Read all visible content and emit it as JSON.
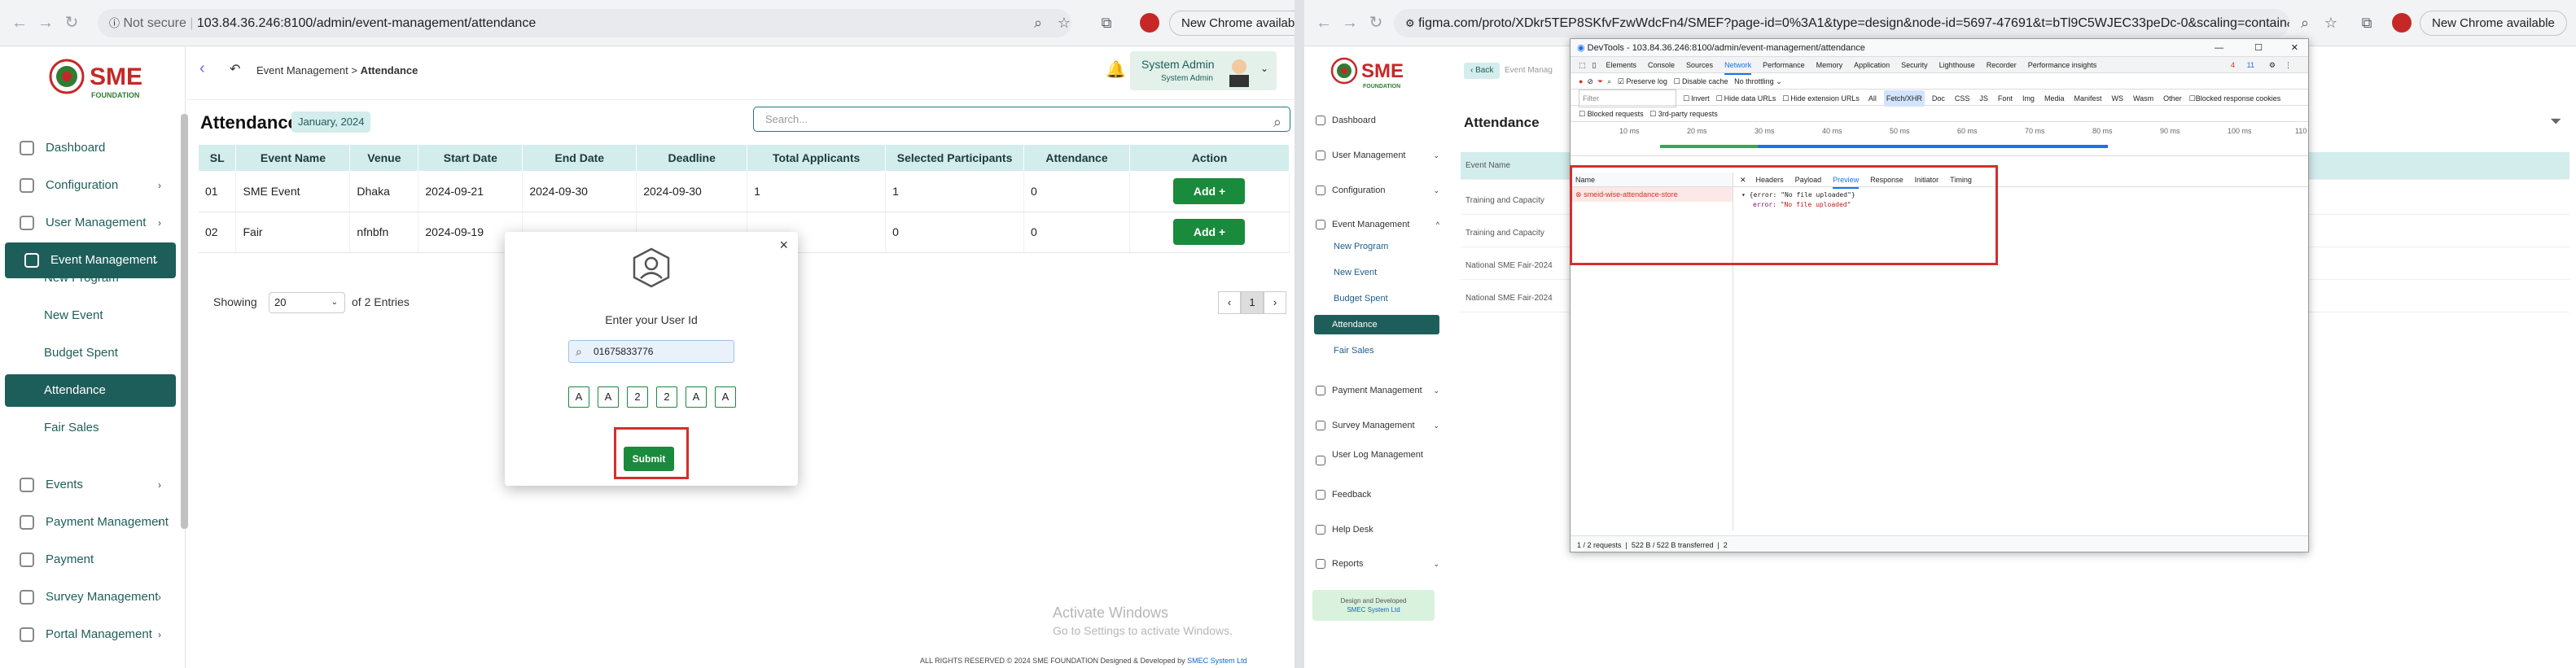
{
  "left_browser": {
    "url_security": "Not secure",
    "url": "103.84.36.246:8100/admin/event-management/attendance",
    "new_chrome": "New Chrome available"
  },
  "app": {
    "breadcrumb": {
      "parent": "Event Management",
      "sep": ">",
      "current": "Attendance"
    },
    "user": {
      "name": "System Admin",
      "role": "System Admin"
    },
    "menu": [
      {
        "label": "Dashboard",
        "icon": "grid-icon",
        "chevron": ""
      },
      {
        "label": "Configuration",
        "icon": "gear-icon",
        "chevron": "›"
      },
      {
        "label": "User Management",
        "icon": "users-icon",
        "chevron": "›"
      },
      {
        "label": "Event Management",
        "icon": "calendar-icon",
        "chevron": "⌄"
      },
      {
        "label": "Events",
        "icon": "star-icon",
        "chevron": "›"
      },
      {
        "label": "Payment Management",
        "icon": "payment-icon",
        "chevron": "›"
      },
      {
        "label": "Payment",
        "icon": "wallet-icon",
        "chevron": ""
      },
      {
        "label": "Survey Management",
        "icon": "survey-icon",
        "chevron": "›"
      },
      {
        "label": "Portal Management",
        "icon": "portal-icon",
        "chevron": "›"
      }
    ],
    "submenu": [
      "New Program",
      "New Event",
      "Budget Spent",
      "Attendance",
      "Fair Sales"
    ],
    "title": "Attendance",
    "date_badge": "January, 2024",
    "search_placeholder": "Search...",
    "table": {
      "headers": [
        "SL",
        "Event Name",
        "Venue",
        "Start Date",
        "End Date",
        "Deadline",
        "Total Applicants",
        "Selected Participants",
        "Attendance",
        "Action"
      ],
      "rows": [
        [
          "01",
          "SME Event",
          "Dhaka",
          "2024-09-21",
          "2024-09-30",
          "2024-09-30",
          "1",
          "1",
          "0",
          "Add +"
        ],
        [
          "02",
          "Fair",
          "nfnbfn",
          "2024-09-19",
          "",
          "",
          "",
          "0",
          "0",
          "Add +"
        ]
      ]
    },
    "showing": "Showing",
    "page_size": "20",
    "entries_text": "of 2 Entries",
    "page": "1",
    "modal": {
      "close": "×",
      "prompt": "Enter your User Id",
      "user_id": "01675833776",
      "captcha": [
        "A",
        "A",
        "2",
        "2",
        "A",
        "A"
      ],
      "submit": "Submit"
    },
    "activate": {
      "title": "Activate Windows",
      "sub": "Go to Settings to activate Windows."
    },
    "footer": {
      "text": "ALL RIGHTS RESERVED © 2024 SME FOUNDATION   Designed & Developed by",
      "link": "SMEC System Ltd"
    }
  },
  "right_browser": {
    "url": "figma.com/proto/XDkr5TEP8SKfvFzwWdcFn4/SMEF?page-id=0%3A1&type=design&node-id=5697-47691&t=bTl9C5WJEC33peDc-0&scaling=contain&starting-point-node-id=...",
    "new_chrome": "New Chrome available",
    "back": "Back",
    "breadcrumb_partial": "Event Manag",
    "title": "Attendance",
    "rows": [
      "Event Name",
      "Training and Capacity",
      "Training and Capacity",
      "National SME Fair-2024",
      "National SME Fair-2024"
    ],
    "menu": [
      {
        "label": "Dashboard",
        "chevron": ""
      },
      {
        "label": "User Management",
        "chevron": "⌄"
      },
      {
        "label": "Configuration",
        "chevron": "⌄"
      },
      {
        "label": "Event Management",
        "chevron": "^"
      },
      {
        "label": "Payment Management",
        "chevron": "⌄"
      },
      {
        "label": "Survey Management",
        "chevron": "⌄"
      },
      {
        "label": "User Log Management",
        "chevron": ""
      },
      {
        "label": "Feedback",
        "chevron": ""
      },
      {
        "label": "Help Desk",
        "chevron": ""
      },
      {
        "label": "Reports",
        "chevron": "⌄"
      }
    ],
    "submenu": [
      "New Program",
      "New Event",
      "Budget Spent",
      "Attendance",
      "Fair Sales"
    ],
    "design_credit": "Design and Developed",
    "design_link": "SMEC System Ltd"
  },
  "devtools": {
    "title": "DevTools - 103.84.36.246:8100/admin/event-management/attendance",
    "tabs": [
      "Elements",
      "Console",
      "Sources",
      "Network",
      "Performance",
      "Memory",
      "Application",
      "Security",
      "Lighthouse",
      "Recorder",
      "Performance insights"
    ],
    "active_tab": "Network",
    "badges": {
      "errors": "4",
      "warnings": "11"
    },
    "toolbar": {
      "preserve_log": "Preserve log",
      "disable_cache": "Disable cache",
      "throttling": "No throttling"
    },
    "filter": {
      "placeholder": "Filter",
      "invert": "Invert",
      "hide_data": "Hide data URLs",
      "hide_ext": "Hide extension URLs",
      "types": [
        "All",
        "Fetch/XHR",
        "Doc",
        "CSS",
        "JS",
        "Font",
        "Img",
        "Media",
        "Manifest",
        "WS",
        "Wasm",
        "Other"
      ],
      "blocked_cookies": "Blocked response cookies",
      "blocked_req": "Blocked requests",
      "third_party": "3rd-party requests"
    },
    "timeline": [
      "10 ms",
      "20 ms",
      "30 ms",
      "40 ms",
      "50 ms",
      "60 ms",
      "70 ms",
      "80 ms",
      "90 ms",
      "100 ms",
      "110"
    ],
    "name_header": "Name",
    "request_name": "smeid-wise-attendance-store",
    "detail_tabs": [
      "Headers",
      "Payload",
      "Preview",
      "Response",
      "Initiator",
      "Timing"
    ],
    "detail_active": "Preview",
    "preview_line1": "{error: \"No file uploaded\"}",
    "preview_key": "error:",
    "preview_val": "\"No file uploaded\"",
    "status": {
      "requests": "1 / 2 requests",
      "transferred": "522 B / 522 B transferred",
      "extra": "2"
    }
  }
}
